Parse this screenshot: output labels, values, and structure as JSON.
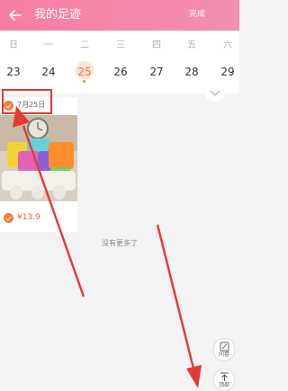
{
  "header": {
    "title": "我的足迹",
    "done_label": "完成",
    "background": "#f77ea0"
  },
  "calendar": {
    "weekdays": [
      "日",
      "一",
      "二",
      "三",
      "四",
      "五",
      "六"
    ],
    "dates": [
      "23",
      "24",
      "25",
      "26",
      "27",
      "28",
      "29"
    ],
    "selected_date": "25",
    "accent": "#ff6a3d"
  },
  "footprints": [
    {
      "date": "7月25日",
      "price": "¥13.9",
      "checked": true
    }
  ],
  "list_end": {
    "text": "没有更多了"
  },
  "side_actions": {
    "feedback_label": "问卷",
    "top_label": "顶部"
  },
  "annotation_color": "#e53935"
}
